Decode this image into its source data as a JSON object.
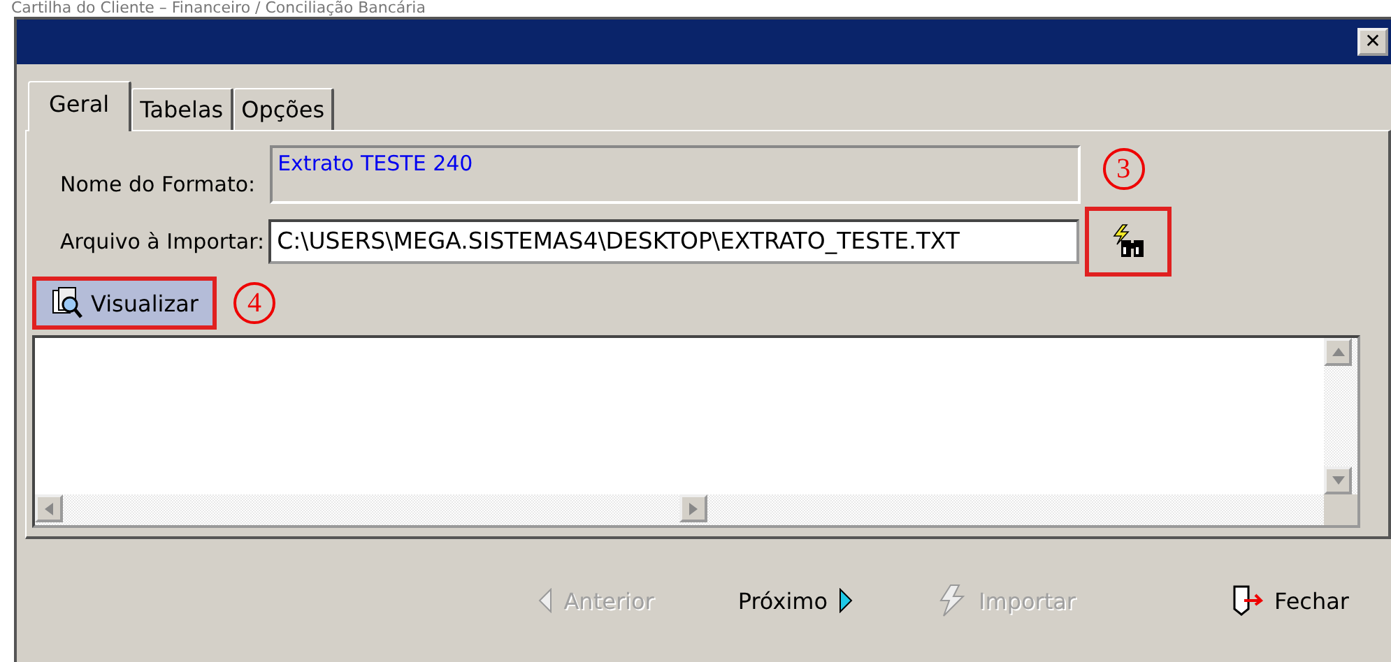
{
  "caption": "Cartilha do Cliente – Financeiro / Conciliação Bancária",
  "window": {
    "close": "✕"
  },
  "tabs": [
    {
      "label": "Geral",
      "selected": true
    },
    {
      "label": "Tabelas",
      "selected": false
    },
    {
      "label": "Opções",
      "selected": false
    }
  ],
  "fields": [
    {
      "label": "Nome do Formato:",
      "value": "Extrato TESTE 240",
      "disabled": true
    },
    {
      "label": "Arquivo à Importar:",
      "value": "C:\\USERS\\MEGA.SISTEMAS4\\DESKTOP\\EXTRATO_TESTE.TXT",
      "disabled": false
    }
  ],
  "browse_button": {
    "highlighted": true,
    "annotation": "3"
  },
  "preview_button": {
    "label": "Visualizar",
    "highlighted": true,
    "annotation": "4"
  },
  "footer_buttons": [
    {
      "kind": "back",
      "label": "Anterior",
      "disabled": true
    },
    {
      "kind": "next",
      "label": "Próximo",
      "disabled": false
    },
    {
      "kind": "import",
      "label": "Importar",
      "disabled": true
    },
    {
      "kind": "close",
      "label": "Fechar",
      "disabled": false
    }
  ]
}
